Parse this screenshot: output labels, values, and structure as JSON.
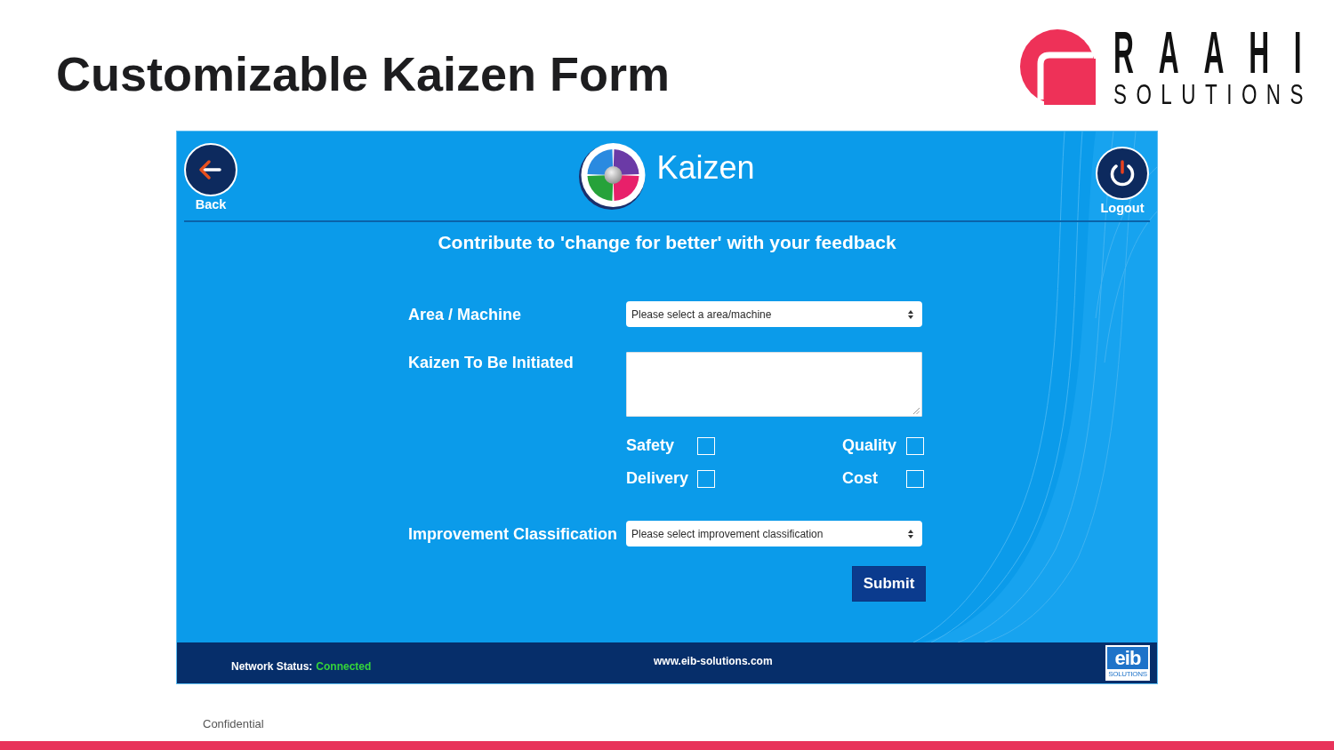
{
  "slide": {
    "title": "Customizable Kaizen Form",
    "footer_note": "Confidential"
  },
  "brand": {
    "name": "RAAHI",
    "tagline": "SOLUTIONS"
  },
  "app": {
    "header": {
      "back_label": "Back",
      "title": "Kaizen",
      "logout_label": "Logout"
    },
    "subtitle": "Contribute to 'change for better' with your feedback",
    "fields": [
      {
        "kind": "select",
        "label": "Area / Machine",
        "placeholder": "Please select a area/machine"
      },
      {
        "kind": "textarea",
        "label": "Kaizen To Be Initiated"
      },
      {
        "kind": "checkboxes",
        "options": [
          {
            "label": "Safety",
            "checked": false
          },
          {
            "label": "Quality",
            "checked": false
          },
          {
            "label": "Delivery",
            "checked": false
          },
          {
            "label": "Cost",
            "checked": false
          }
        ]
      },
      {
        "kind": "select",
        "label": "Improvement Classification",
        "placeholder": "Please select improvement classification"
      }
    ],
    "submit_label": "Submit",
    "status_bar": {
      "network_label": "Network Status:",
      "network_value": "Connected",
      "website": "www.eib-solutions.com",
      "logo": {
        "name": "eib",
        "tagline": "SOLUTIONS"
      }
    }
  }
}
